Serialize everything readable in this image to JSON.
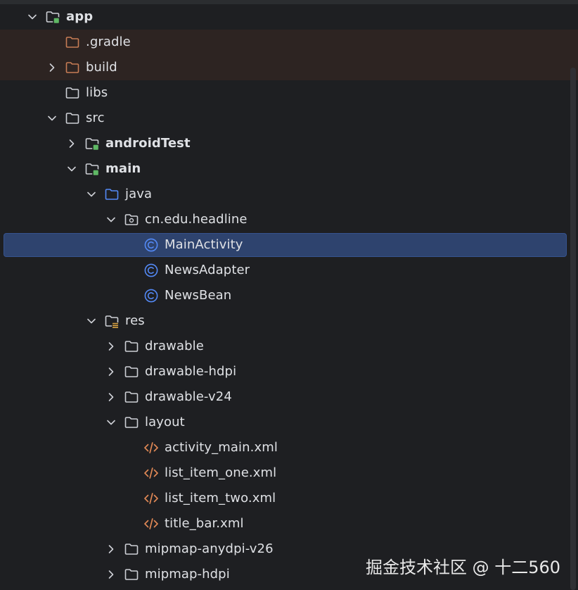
{
  "tree": [
    {
      "id": "app",
      "label": "app",
      "depth": 0,
      "expander": "expanded",
      "icon": "module-folder-icon",
      "bold": true
    },
    {
      "id": "gradle",
      "label": ".gradle",
      "depth": 1,
      "expander": "none",
      "icon": "excluded-folder-icon",
      "excluded": true
    },
    {
      "id": "build",
      "label": "build",
      "depth": 1,
      "expander": "collapsed",
      "icon": "excluded-folder-icon",
      "excluded": true
    },
    {
      "id": "libs",
      "label": "libs",
      "depth": 1,
      "expander": "none",
      "icon": "folder-icon"
    },
    {
      "id": "src",
      "label": "src",
      "depth": 1,
      "expander": "expanded",
      "icon": "folder-icon"
    },
    {
      "id": "androidtest",
      "label": "androidTest",
      "depth": 2,
      "expander": "collapsed",
      "icon": "module-folder-icon",
      "bold": true
    },
    {
      "id": "main",
      "label": "main",
      "depth": 2,
      "expander": "expanded",
      "icon": "module-folder-icon",
      "bold": true
    },
    {
      "id": "java",
      "label": "java",
      "depth": 3,
      "expander": "expanded",
      "icon": "source-folder-icon"
    },
    {
      "id": "package",
      "label": "cn.edu.headline",
      "depth": 4,
      "expander": "expanded",
      "icon": "package-icon"
    },
    {
      "id": "mainactivity",
      "label": "MainActivity",
      "depth": 5,
      "expander": "none",
      "icon": "class-icon",
      "selected": true
    },
    {
      "id": "newsadapter",
      "label": "NewsAdapter",
      "depth": 5,
      "expander": "none",
      "icon": "class-icon"
    },
    {
      "id": "newsbean",
      "label": "NewsBean",
      "depth": 5,
      "expander": "none",
      "icon": "class-icon"
    },
    {
      "id": "res",
      "label": "res",
      "depth": 3,
      "expander": "expanded",
      "icon": "resources-folder-icon"
    },
    {
      "id": "drawable",
      "label": "drawable",
      "depth": 4,
      "expander": "collapsed",
      "icon": "folder-icon"
    },
    {
      "id": "drawable-hdpi",
      "label": "drawable-hdpi",
      "depth": 4,
      "expander": "collapsed",
      "icon": "folder-icon"
    },
    {
      "id": "drawable-v24",
      "label": "drawable-v24",
      "depth": 4,
      "expander": "collapsed",
      "icon": "folder-icon"
    },
    {
      "id": "layout",
      "label": "layout",
      "depth": 4,
      "expander": "expanded",
      "icon": "folder-icon"
    },
    {
      "id": "activity-main",
      "label": "activity_main.xml",
      "depth": 5,
      "expander": "none",
      "icon": "xml-file-icon"
    },
    {
      "id": "list-item-one",
      "label": "list_item_one.xml",
      "depth": 5,
      "expander": "none",
      "icon": "xml-file-icon"
    },
    {
      "id": "list-item-two",
      "label": "list_item_two.xml",
      "depth": 5,
      "expander": "none",
      "icon": "xml-file-icon"
    },
    {
      "id": "title-bar",
      "label": "title_bar.xml",
      "depth": 5,
      "expander": "none",
      "icon": "xml-file-icon"
    },
    {
      "id": "mipmap-anydpi",
      "label": "mipmap-anydpi-v26",
      "depth": 4,
      "expander": "collapsed",
      "icon": "folder-icon"
    },
    {
      "id": "mipmap-hdpi",
      "label": "mipmap-hdpi",
      "depth": 4,
      "expander": "collapsed",
      "icon": "folder-icon"
    }
  ],
  "watermark": "掘金技术社区 @ 十二560",
  "colors": {
    "background": "#1e1f22",
    "text": "#dfe1e5",
    "selection": "#2e436e",
    "excluded_row": "#2d2422",
    "excluded_folder": "#c77d55",
    "module_badge": "#5fb865",
    "source_folder": "#548af7",
    "class_icon": "#548af7",
    "xml_icon": "#e08855",
    "resources_bars": "#d9a343"
  }
}
